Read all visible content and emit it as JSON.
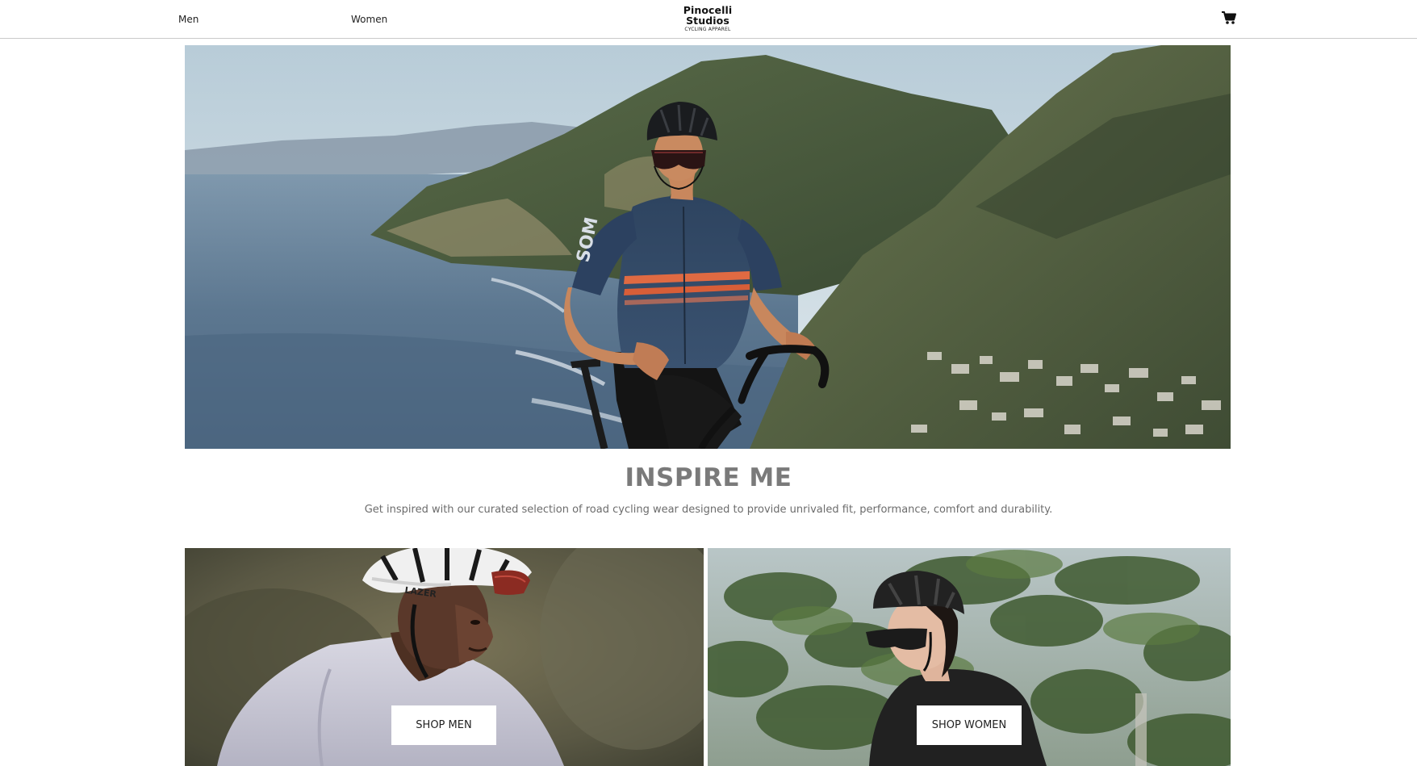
{
  "header": {
    "nav": [
      {
        "label": "Men"
      },
      {
        "label": "Women"
      }
    ],
    "logo": {
      "line1": "Pinocelli",
      "line2": "Studios",
      "tagline": "CYCLING APPAREL"
    },
    "cart_icon": "shopping-cart-icon"
  },
  "hero": {
    "jersey_text": "SOM",
    "alt": "cyclist-on-coastal-cliff"
  },
  "intro": {
    "title": "INSPIRE ME",
    "text": "Get inspired with our curated selection of road cycling wear designed to provide unrivaled fit, performance, comfort and durability."
  },
  "tiles": [
    {
      "button": "SHOP MEN",
      "helmet_text": "LAZER"
    },
    {
      "button": "SHOP WOMEN"
    }
  ],
  "colors": {
    "title_gray": "#7a7a7a",
    "text_gray": "#6c6c6c",
    "divider": "#c9c9c9"
  }
}
